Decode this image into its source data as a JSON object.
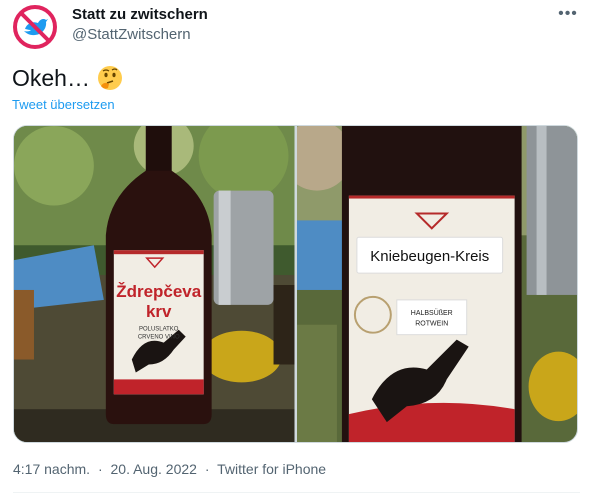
{
  "author": {
    "name": "Statt zu zwitschern",
    "handle": "@StattZwitschern"
  },
  "more_icon": "ellipsis-icon",
  "tweet": {
    "text": "Okeh…",
    "emoji": "thinking-face-emoji",
    "translate_label": "Tweet übersetzen"
  },
  "photos": {
    "left": {
      "label_line1": "Ždrepčeva",
      "label_line2": "krv",
      "label_small1": "POLUSLATKO",
      "label_small2": "CRVENO VINO"
    },
    "right": {
      "sticker_text": "Kniebeugen-Kreis",
      "small_line1": "HALBSÜßER",
      "small_line2": "ROTWEIN"
    }
  },
  "meta": {
    "time": "4:17 nachm.",
    "dot1": "·",
    "date": "20. Aug. 2022",
    "dot2": "·",
    "source": "Twitter for iPhone"
  },
  "colors": {
    "accent": "#1d9bf0",
    "avatar_ring": "#e0245e",
    "bird": "#1d9bf0"
  }
}
